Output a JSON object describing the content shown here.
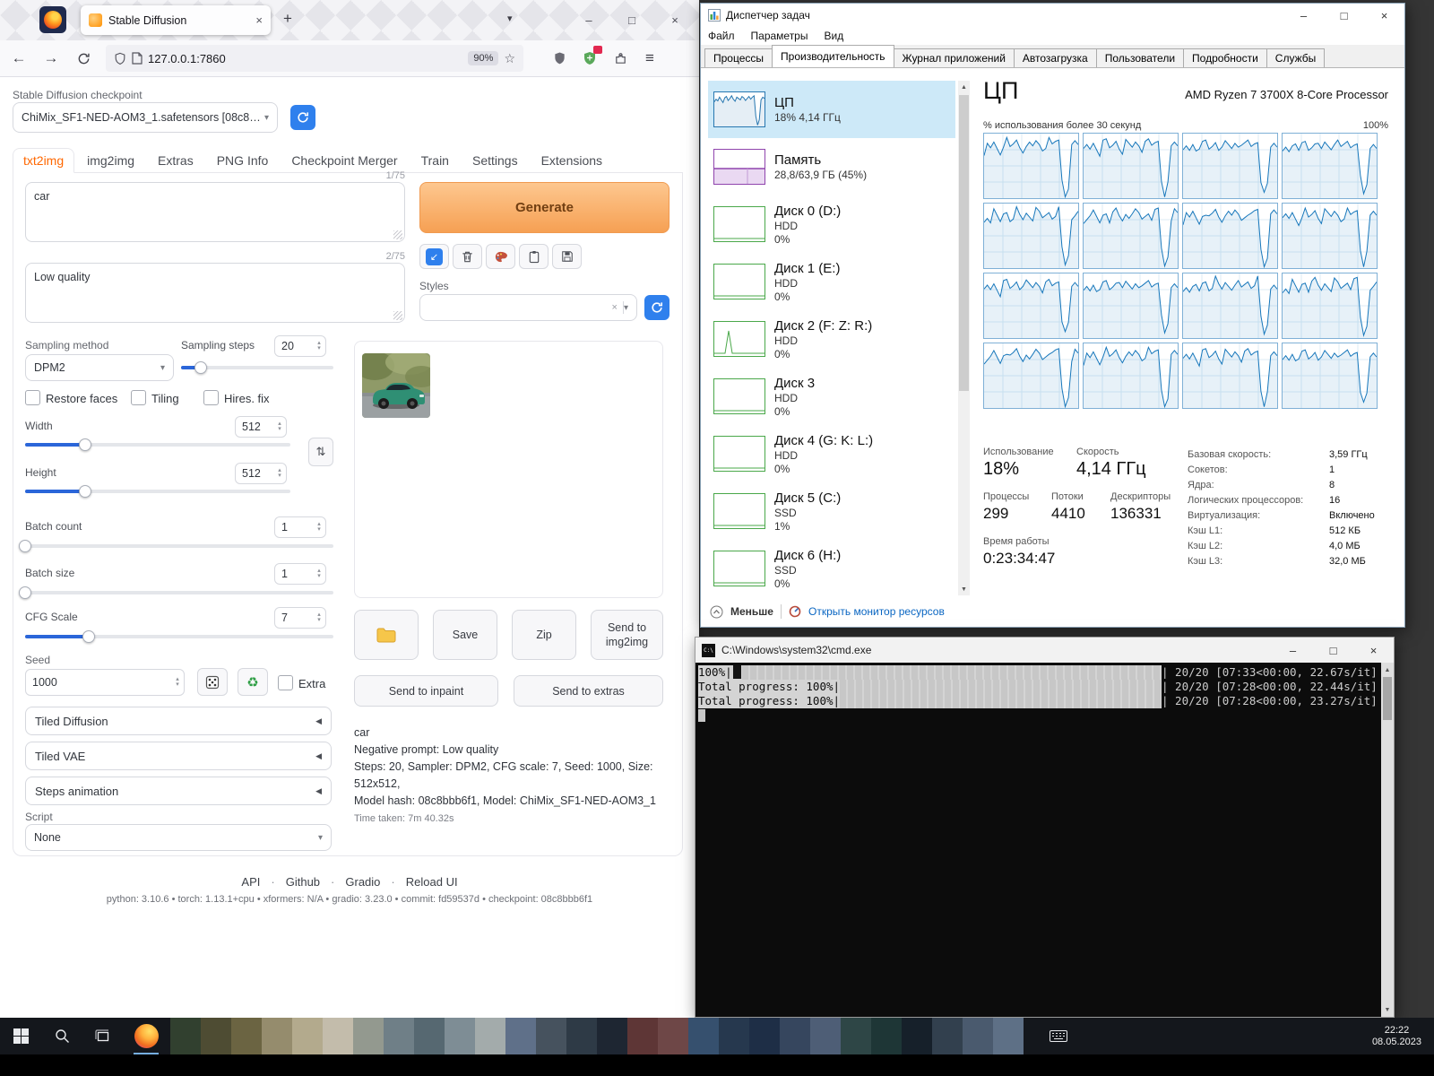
{
  "browser": {
    "tab_title": "Stable Diffusion",
    "url": "127.0.0.1:7860",
    "zoom_badge": "90%"
  },
  "sd": {
    "checkpoint_label": "Stable Diffusion checkpoint",
    "checkpoint_value": "ChiMix_SF1-NED-AOM3_1.safetensors [08c8bbb6f...",
    "tabs": [
      {
        "label": "txt2img",
        "active": true
      },
      {
        "label": "img2img"
      },
      {
        "label": "Extras"
      },
      {
        "label": "PNG Info"
      },
      {
        "label": "Checkpoint Merger"
      },
      {
        "label": "Train"
      },
      {
        "label": "Settings"
      },
      {
        "label": "Extensions"
      }
    ],
    "prompt": {
      "value": "car",
      "counter": "1/75"
    },
    "negative_prompt": {
      "value": "Low quality",
      "counter": "2/75"
    },
    "generate_label": "Generate",
    "styles_label": "Styles",
    "sampling_method_label": "Sampling method",
    "sampling_method_value": "DPM2",
    "checkboxes": [
      "Restore faces",
      "Tiling",
      "Hires. fix"
    ],
    "sliders": {
      "steps": {
        "label": "Sampling steps",
        "value": "20",
        "min": 1,
        "max": 150
      },
      "width": {
        "label": "Width",
        "value": "512",
        "min": 64,
        "max": 2048
      },
      "height": {
        "label": "Height",
        "value": "512",
        "min": 64,
        "max": 2048
      },
      "batch_count": {
        "label": "Batch count",
        "value": "1",
        "min": 1,
        "max": 100
      },
      "batch_size": {
        "label": "Batch size",
        "value": "1",
        "min": 1,
        "max": 8
      },
      "cfg": {
        "label": "CFG Scale",
        "value": "7",
        "min": 1,
        "max": 30
      }
    },
    "seed_label": "Seed",
    "seed_value": "1000",
    "extra_label": "Extra",
    "accordions": [
      "Tiled Diffusion",
      "Tiled VAE",
      "Steps animation"
    ],
    "script_label": "Script",
    "script_value": "None",
    "gallery_buttons": [
      "Save",
      "Zip",
      "Send to img2img"
    ],
    "send_inpaint": "Send to inpaint",
    "send_extras": "Send to extras",
    "output_info": {
      "prompt": "car",
      "negative": "Negative prompt: Low quality",
      "params": "Steps: 20, Sampler: DPM2, CFG scale: 7, Seed: 1000, Size: 512x512,",
      "model": "Model hash: 08c8bbb6f1, Model: ChiMix_SF1-NED-AOM3_1",
      "time": "Time taken: 7m 40.32s"
    },
    "footer_links": [
      "API",
      "Github",
      "Gradio",
      "Reload UI"
    ],
    "footer_sep": "·",
    "footer_info": "python: 3.10.6  •  torch: 1.13.1+cpu  •  xformers: N/A  •  gradio: 3.23.0  •  commit: fd59537d  •  checkpoint: 08c8bbb6f1"
  },
  "taskmgr": {
    "title": "Диспетчер задач",
    "menu": [
      "Файл",
      "Параметры",
      "Вид"
    ],
    "tabs": [
      {
        "label": "Процессы"
      },
      {
        "label": "Производительность",
        "active": true
      },
      {
        "label": "Журнал приложений"
      },
      {
        "label": "Автозагрузка"
      },
      {
        "label": "Пользователи"
      },
      {
        "label": "Подробности"
      },
      {
        "label": "Службы"
      }
    ],
    "sidebar": [
      {
        "name": "ЦП",
        "sub": "18%  4,14 ГГц",
        "type": "cpu",
        "selected": true
      },
      {
        "name": "Память",
        "sub": "28,8/63,9 ГБ (45%)",
        "type": "mem"
      },
      {
        "name": "Диск 0 (D:)",
        "sub": "HDD",
        "sub2": "0%",
        "type": "disk"
      },
      {
        "name": "Диск 1 (E:)",
        "sub": "HDD",
        "sub2": "0%",
        "type": "disk"
      },
      {
        "name": "Диск 2 (F: Z: R:)",
        "sub": "HDD",
        "sub2": "0%",
        "type": "disk",
        "spike": true
      },
      {
        "name": "Диск 3",
        "sub": "HDD",
        "sub2": "0%",
        "type": "disk"
      },
      {
        "name": "Диск 4 (G: K: L:)",
        "sub": "HDD",
        "sub2": "0%",
        "type": "disk"
      },
      {
        "name": "Диск 5 (C:)",
        "sub": "SSD",
        "sub2": "1%",
        "type": "disk"
      },
      {
        "name": "Диск 6 (H:)",
        "sub": "SSD",
        "sub2": "0%",
        "type": "disk"
      }
    ],
    "cpu": {
      "heading": "ЦП",
      "processor": "AMD Ryzen 7 3700X 8-Core Processor",
      "graph_caption": "% использования более 30 секунд",
      "graph_max": "100%",
      "stats": [
        {
          "label": "Использование",
          "value": "18%"
        },
        {
          "label": "Скорость",
          "value": "4,14 ГГц"
        },
        {
          "label": "Процессы",
          "value": "299"
        },
        {
          "label": "Потоки",
          "value": "4410"
        },
        {
          "label": "Дескрипторы",
          "value": "136331"
        },
        {
          "label": "Время работы",
          "value": "0:23:34:47"
        }
      ],
      "details": [
        {
          "label": "Базовая скорость:",
          "value": "3,59 ГГц"
        },
        {
          "label": "Сокетов:",
          "value": "1"
        },
        {
          "label": "Ядра:",
          "value": "8"
        },
        {
          "label": "Логических процессоров:",
          "value": "16"
        },
        {
          "label": "Виртуализация:",
          "value": "Включено"
        },
        {
          "label": "Кэш L1:",
          "value": "512 КБ"
        },
        {
          "label": "Кэш L2:",
          "value": "4,0 МБ"
        },
        {
          "label": "Кэш L3:",
          "value": "32,0 МБ"
        }
      ],
      "core_curve": [
        72,
        80,
        75,
        86,
        78,
        70,
        84,
        88,
        76,
        82,
        90,
        80,
        74,
        86,
        82,
        78,
        88,
        84,
        76,
        82,
        88,
        80,
        86,
        90,
        30,
        4,
        20,
        78,
        86,
        82
      ]
    },
    "footer": {
      "less_label": "Меньше",
      "resmon_label": "Открыть монитор ресурсов"
    }
  },
  "cmd": {
    "title": "C:\\Windows\\system32\\cmd.exe",
    "lines": [
      {
        "left": "100%|",
        "right": "| 20/20 [07:33<00:00, 22.67s/it]",
        "cursor": true
      },
      {
        "left": "Total progress: 100%|",
        "right": "| 20/20 [07:28<00:00, 22.44s/it]"
      },
      {
        "left": "Total progress: 100%|",
        "right": "| 20/20 [07:28<00:00, 23.27s/it]"
      }
    ]
  },
  "taskbar": {
    "time": "22:22",
    "date": "08.05.2023",
    "strip_colors": [
      "#31402f",
      "#4e4c33",
      "#6b6442",
      "#958c6d",
      "#b3aa8d",
      "#c3bcab",
      "#93998f",
      "#6f7f87",
      "#566871",
      "#7e8d95",
      "#a3abab",
      "#5f7089",
      "#46525e",
      "#2e3a46",
      "#1e2632",
      "#5e3636",
      "#6e4747",
      "#36506e",
      "#26384e",
      "#1e2e46",
      "#36465e",
      "#4e5e76",
      "#2e4646",
      "#1e3636",
      "#16202a",
      "#32404e",
      "#4a5a6e",
      "#5e7086"
    ]
  },
  "colors": {
    "accent_orange": "#ff6700",
    "accent_blue": "#2f80ed",
    "taskmgr_blue": "#1777bb",
    "selection_blue": "#cde9f8"
  }
}
